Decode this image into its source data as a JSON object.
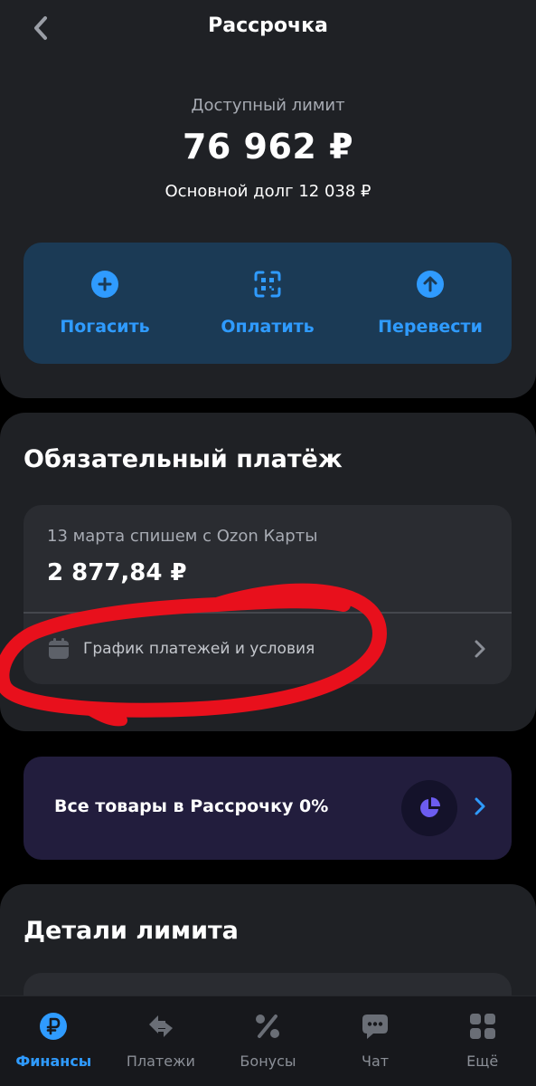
{
  "header": {
    "title": "Рассрочка"
  },
  "limit": {
    "label": "Доступный лимит",
    "value": "76 962 ₽",
    "debt": "Основной долг 12 038 ₽"
  },
  "actions": [
    {
      "label": "Погасить",
      "icon": "plus-circle-icon"
    },
    {
      "label": "Оплатить",
      "icon": "qr-scan-icon"
    },
    {
      "label": "Перевести",
      "icon": "arrow-up-circle-icon"
    }
  ],
  "payment": {
    "title": "Обязательный платёж",
    "date_text": "13 марта спишем с Ozon Карты",
    "amount": "2 877,84 ₽",
    "schedule_label": "График платежей и условия"
  },
  "promo": {
    "label": "Все товары в Рассрочку 0%"
  },
  "limit_details": {
    "title": "Детали лимита"
  },
  "nav": [
    {
      "label": "Финансы",
      "icon": "ruble-icon",
      "active": true
    },
    {
      "label": "Платежи",
      "icon": "transfer-arrows-icon",
      "active": false
    },
    {
      "label": "Бонусы",
      "icon": "percent-icon",
      "active": false
    },
    {
      "label": "Чат",
      "icon": "chat-bubble-icon",
      "active": false
    },
    {
      "label": "Ещё",
      "icon": "grid-icon",
      "active": false
    }
  ],
  "colors": {
    "accent": "#2f9bff",
    "background": "#000000",
    "card": "#1f2125",
    "action_panel": "#1b3a55",
    "promo_panel": "#221d3d",
    "annotation": "#e8101c"
  }
}
